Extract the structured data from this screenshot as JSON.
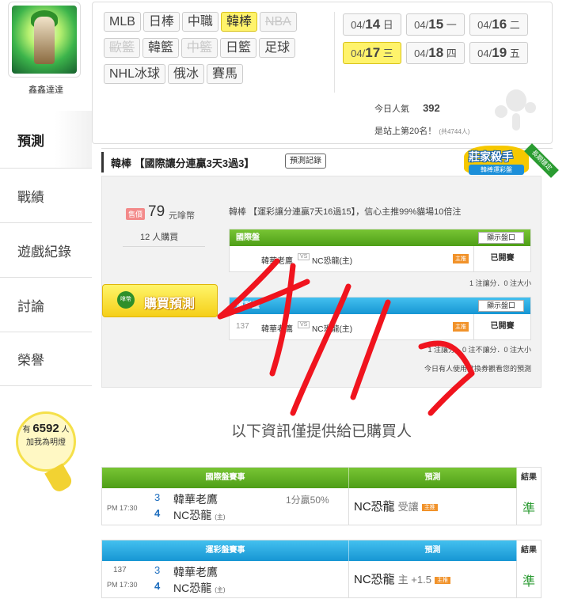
{
  "user": {
    "name": "鑫鑫達達"
  },
  "nav": [
    "預測",
    "戰績",
    "遊戲紀錄",
    "討論",
    "榮譽"
  ],
  "fans": {
    "prefix": "有",
    "count": "6592",
    "unit": "人",
    "suffix": "加我為明燈"
  },
  "sports": [
    {
      "label": "MLB",
      "state": "normal"
    },
    {
      "label": "日棒",
      "state": "normal"
    },
    {
      "label": "中職",
      "state": "normal"
    },
    {
      "label": "韓棒",
      "state": "selected"
    },
    {
      "label": "NBA",
      "state": "disabled"
    },
    {
      "label": "歐籃",
      "state": "disabled"
    },
    {
      "label": "韓籃",
      "state": "normal"
    },
    {
      "label": "中籃",
      "state": "disabled"
    },
    {
      "label": "日籃",
      "state": "normal"
    },
    {
      "label": "足球",
      "state": "normal"
    },
    {
      "label": "NHL冰球",
      "state": "normal"
    },
    {
      "label": "俄冰",
      "state": "normal"
    },
    {
      "label": "賽馬",
      "state": "normal"
    }
  ],
  "dates": [
    {
      "md": "04/",
      "d": "14",
      "w": "日",
      "selected": false
    },
    {
      "md": "04/",
      "d": "15",
      "w": "一",
      "selected": false
    },
    {
      "md": "04/",
      "d": "16",
      "w": "二",
      "selected": false
    },
    {
      "md": "04/",
      "d": "17",
      "w": "三",
      "selected": true
    },
    {
      "md": "04/",
      "d": "18",
      "w": "四",
      "selected": false
    },
    {
      "md": "04/",
      "d": "19",
      "w": "五",
      "selected": false
    }
  ],
  "stats": {
    "popularity_label": "今日人氣",
    "popularity": "392",
    "rank_text": "是站上第20名！",
    "rank_total": "(共4744人)"
  },
  "prediction": {
    "title": "韓棒 【國際讓分連贏3天3過3】",
    "record_button": "預測記錄",
    "badge_title": "莊家殺手",
    "badge_sub": "韓棒運彩盤",
    "badge_ribbon": "長期穩定",
    "price_tag": "售價",
    "price": "79",
    "price_unit": "元嗱幣",
    "buyers": "12 人購買",
    "buy_button": "購買預測",
    "buy_icon_text": "嗱幣",
    "description": "韓棒 【運彩讓分連贏7天16過15】，信心主推99%貓場10倍注",
    "intl": {
      "header": "國際盤",
      "show_button": "顯示盤口",
      "team1": "韓華老鷹",
      "vs": "VS",
      "team2": "NC恐龍(主)",
      "tag": "主推",
      "status": "已開賽",
      "note": "1 注讓分．0 注大小"
    },
    "sports_lottery": {
      "header": "運彩盤",
      "show_button": "顯示盤口",
      "no": "137",
      "team1": "韓華老鷹",
      "vs": "VS",
      "team2": "NC恐龍(主)",
      "tag": "主推",
      "status": "已開賽",
      "note": "1 注讓分．0 注不讓分．0 注大小",
      "note2": "今日有人使用兌換券觀看您的預測"
    }
  },
  "info_message": "以下資訊僅提供給已購買人",
  "results": [
    {
      "header": "國際盤賽事",
      "pick_header": "預測",
      "result_header": "結果",
      "color": "green",
      "no": "",
      "time": "PM 17:30",
      "score1": "3",
      "team1": "韓華老鷹",
      "score2": "4",
      "team2": "NC恐龍",
      "home": "(主)",
      "extra": "1分贏50%",
      "pick_team": "NC恐龍",
      "pick_mod": "受讓",
      "pick_tag": "主推",
      "result": "準"
    },
    {
      "header": "運彩盤賽事",
      "pick_header": "預測",
      "result_header": "結果",
      "color": "blue",
      "no": "137",
      "time": "PM 17:30",
      "score1": "3",
      "team1": "韓華老鷹",
      "score2": "4",
      "team2": "NC恐龍",
      "home": "(主)",
      "extra": "",
      "pick_team": "NC恐龍",
      "pick_mod": "主 +1.5",
      "pick_tag": "主推",
      "result": "準"
    }
  ],
  "colors": {
    "selected": "#fff36b",
    "green_header": "#5fae21",
    "blue_header": "#1fa3de",
    "scribble": "#f0141e",
    "result_text": "#2c9b33"
  }
}
